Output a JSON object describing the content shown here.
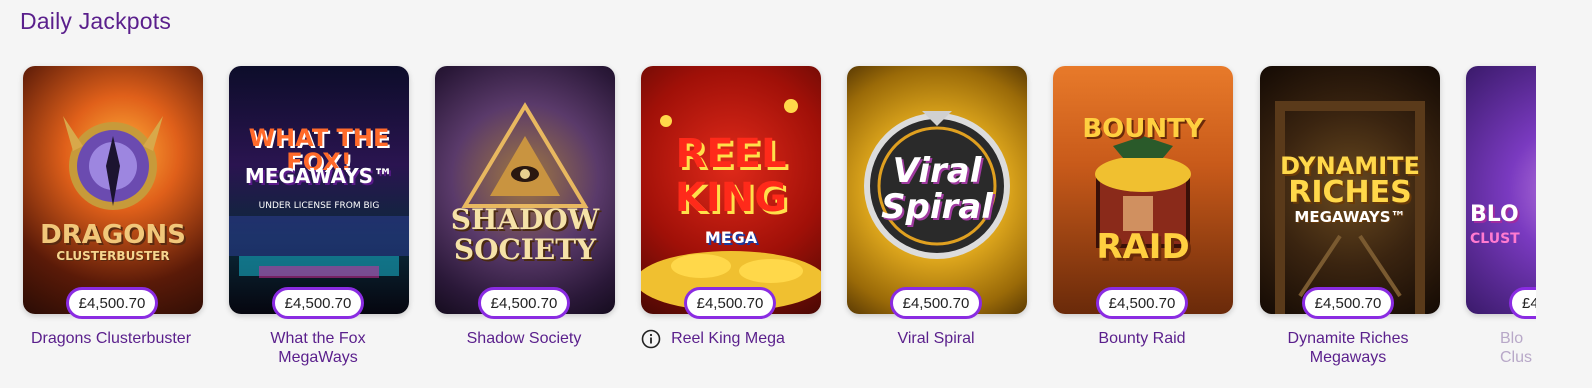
{
  "section": {
    "title": "Daily Jackpots"
  },
  "games": [
    {
      "name": "Dragons Clusterbuster",
      "jackpot": "£4,500.70",
      "art_line1": "DRAGONS",
      "art_line2": "CLUSTERBUSTER",
      "art_line3": ""
    },
    {
      "name": "What the Fox MegaWays",
      "jackpot": "£4,500.70",
      "art_line1": "WHAT THE FOX!",
      "art_line2": "MEGAWAYS™",
      "art_line3": "UNDER LICENSE FROM BIG"
    },
    {
      "name": "Shadow Society",
      "jackpot": "£4,500.70",
      "art_line1": "SHADOW",
      "art_line2": "SOCIETY",
      "art_line3": ""
    },
    {
      "name": "Reel King Mega",
      "jackpot": "£4,500.70",
      "art_line1": "REEL",
      "art_line2": "KING",
      "art_line3": "MEGA"
    },
    {
      "name": "Viral Spiral",
      "jackpot": "£4,500.70",
      "art_line1": "Viral",
      "art_line2": "Spiral",
      "art_line3": ""
    },
    {
      "name": "Bounty Raid",
      "jackpot": "£4,500.70",
      "art_line1": "BOUNTY",
      "art_line2": "RAID",
      "art_line3": ""
    },
    {
      "name": "Dynamite Riches Megaways",
      "jackpot": "£4,500.70",
      "art_line1": "DYNAMITE",
      "art_line2": "RICHES",
      "art_line3": "MEGAWAYS™"
    },
    {
      "name": "Blo… Clus…",
      "jackpot": "£4",
      "art_line1": "BLO",
      "art_line2": "CLUST",
      "art_line3": ""
    }
  ],
  "partial_name": {
    "line1": "Blo",
    "line2": "Clus"
  },
  "colors": {
    "accent": "#8a2be2",
    "title": "#5a1f8c",
    "background": "#f5f5f5"
  },
  "icons": {
    "info": "info-icon"
  }
}
